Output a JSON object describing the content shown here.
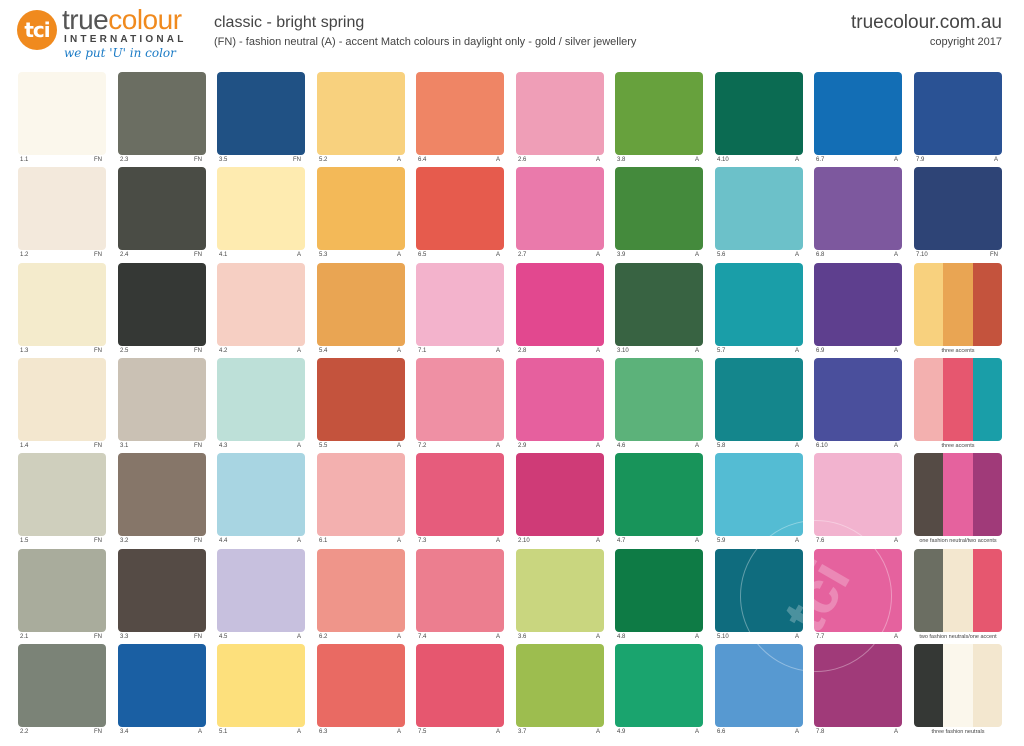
{
  "header": {
    "logo_mark": "tci",
    "brand_part1": "true",
    "brand_part2": "colour",
    "brand_sub": "INTERNATIONAL",
    "tagline": "we put 'U' in color",
    "title": "classic - bright spring",
    "subtitle": "(FN) - fashion neutral    (A) - accent    Match colours in daylight only - gold / silver jewellery",
    "site": "truecolour.com.au",
    "copyright": "copyright 2017"
  },
  "watermark": "tci",
  "columns": [
    [
      {
        "code": "1.1",
        "type": "FN",
        "color": "#fbf7ec"
      },
      {
        "code": "1.2",
        "type": "FN",
        "color": "#f3e9dc"
      },
      {
        "code": "1.3",
        "type": "FN",
        "color": "#f4ebcc"
      },
      {
        "code": "1.4",
        "type": "FN",
        "color": "#f3e7cf"
      },
      {
        "code": "1.5",
        "type": "FN",
        "color": "#cfcfbd"
      },
      {
        "code": "2.1",
        "type": "FN",
        "color": "#a9ac9c"
      },
      {
        "code": "2.2",
        "type": "FN",
        "color": "#7b8377"
      }
    ],
    [
      {
        "code": "2.3",
        "type": "FN",
        "color": "#6b6e62"
      },
      {
        "code": "2.4",
        "type": "FN",
        "color": "#4a4c45"
      },
      {
        "code": "2.5",
        "type": "FN",
        "color": "#353835"
      },
      {
        "code": "3.1",
        "type": "FN",
        "color": "#cac1b4"
      },
      {
        "code": "3.2",
        "type": "FN",
        "color": "#867669"
      },
      {
        "code": "3.3",
        "type": "FN",
        "color": "#554b45"
      },
      {
        "code": "3.4",
        "type": "A",
        "color": "#1a5fa3"
      }
    ],
    [
      {
        "code": "3.5",
        "type": "FN",
        "color": "#205184"
      },
      {
        "code": "4.1",
        "type": "A",
        "color": "#feebb0"
      },
      {
        "code": "4.2",
        "type": "A",
        "color": "#f6cfc3"
      },
      {
        "code": "4.3",
        "type": "A",
        "color": "#bde0d8"
      },
      {
        "code": "4.4",
        "type": "A",
        "color": "#a8d5e2"
      },
      {
        "code": "4.5",
        "type": "A",
        "color": "#c7c0de"
      },
      {
        "code": "5.1",
        "type": "A",
        "color": "#fde07c"
      }
    ],
    [
      {
        "code": "5.2",
        "type": "A",
        "color": "#f8d17e"
      },
      {
        "code": "5.3",
        "type": "A",
        "color": "#f3b958"
      },
      {
        "code": "5.4",
        "type": "A",
        "color": "#e9a553"
      },
      {
        "code": "5.5",
        "type": "A",
        "color": "#c4533d"
      },
      {
        "code": "6.1",
        "type": "A",
        "color": "#f3b0af"
      },
      {
        "code": "6.2",
        "type": "A",
        "color": "#ef958a"
      },
      {
        "code": "6.3",
        "type": "A",
        "color": "#e96a63"
      }
    ],
    [
      {
        "code": "6.4",
        "type": "A",
        "color": "#ef8565"
      },
      {
        "code": "6.5",
        "type": "A",
        "color": "#e65b4d"
      },
      {
        "code": "7.1",
        "type": "A",
        "color": "#f3b3cc"
      },
      {
        "code": "7.2",
        "type": "A",
        "color": "#ef90a4"
      },
      {
        "code": "7.3",
        "type": "A",
        "color": "#e65c7c"
      },
      {
        "code": "7.4",
        "type": "A",
        "color": "#ec7e8f"
      },
      {
        "code": "7.5",
        "type": "A",
        "color": "#e6576f"
      }
    ],
    [
      {
        "code": "2.6",
        "type": "A",
        "color": "#ef9eb7"
      },
      {
        "code": "2.7",
        "type": "A",
        "color": "#ea7aab"
      },
      {
        "code": "2.8",
        "type": "A",
        "color": "#e2488f"
      },
      {
        "code": "2.9",
        "type": "A",
        "color": "#e6609e"
      },
      {
        "code": "2.10",
        "type": "A",
        "color": "#cf3b77"
      },
      {
        "code": "3.6",
        "type": "A",
        "color": "#c9d67f"
      },
      {
        "code": "3.7",
        "type": "A",
        "color": "#9dbd4f"
      }
    ],
    [
      {
        "code": "3.8",
        "type": "A",
        "color": "#67a13d"
      },
      {
        "code": "3.9",
        "type": "A",
        "color": "#448a3c"
      },
      {
        "code": "3.10",
        "type": "A",
        "color": "#386342"
      },
      {
        "code": "4.6",
        "type": "A",
        "color": "#5cb27a"
      },
      {
        "code": "4.7",
        "type": "A",
        "color": "#18945a"
      },
      {
        "code": "4.8",
        "type": "A",
        "color": "#0e7b45"
      },
      {
        "code": "4.9",
        "type": "A",
        "color": "#1aa46e"
      }
    ],
    [
      {
        "code": "4.10",
        "type": "A",
        "color": "#0b6b52"
      },
      {
        "code": "5.6",
        "type": "A",
        "color": "#6cc1c9"
      },
      {
        "code": "5.7",
        "type": "A",
        "color": "#1a9ea8"
      },
      {
        "code": "5.8",
        "type": "A",
        "color": "#14868c"
      },
      {
        "code": "5.9",
        "type": "A",
        "color": "#54bcd3"
      },
      {
        "code": "5.10",
        "type": "A",
        "color": "#0f6c7e"
      },
      {
        "code": "6.6",
        "type": "A",
        "color": "#5799d1"
      }
    ],
    [
      {
        "code": "6.7",
        "type": "A",
        "color": "#136eb5"
      },
      {
        "code": "6.8",
        "type": "A",
        "color": "#7d589e"
      },
      {
        "code": "6.9",
        "type": "A",
        "color": "#5e3f8e"
      },
      {
        "code": "6.10",
        "type": "A",
        "color": "#4a4f9c"
      },
      {
        "code": "7.6",
        "type": "A",
        "color": "#f2b3cf"
      },
      {
        "code": "7.7",
        "type": "A",
        "color": "#e5629e"
      },
      {
        "code": "7.8",
        "type": "A",
        "color": "#a03a79"
      }
    ],
    [
      {
        "code": "7.9",
        "type": "A",
        "color": "#2a5294"
      },
      {
        "code": "7.10",
        "type": "FN",
        "color": "#2e4476"
      },
      {
        "caption": "three accents",
        "parts": [
          "#f8d17e",
          "#e9a553",
          "#c4533d"
        ]
      },
      {
        "caption": "three accents",
        "parts": [
          "#f3b0af",
          "#e6576f",
          "#1a9ea8"
        ]
      },
      {
        "caption": "one fashion neutral/two accents",
        "parts": [
          "#554b45",
          "#e5629e",
          "#a03a79"
        ]
      },
      {
        "caption": "two fashion neutrals/one accent",
        "parts": [
          "#6b6e62",
          "#f3e7cf",
          "#e6576f"
        ]
      },
      {
        "caption": "three fashion neutrals",
        "parts": [
          "#353835",
          "#fbf7ec",
          "#f3e7cf"
        ]
      }
    ]
  ]
}
